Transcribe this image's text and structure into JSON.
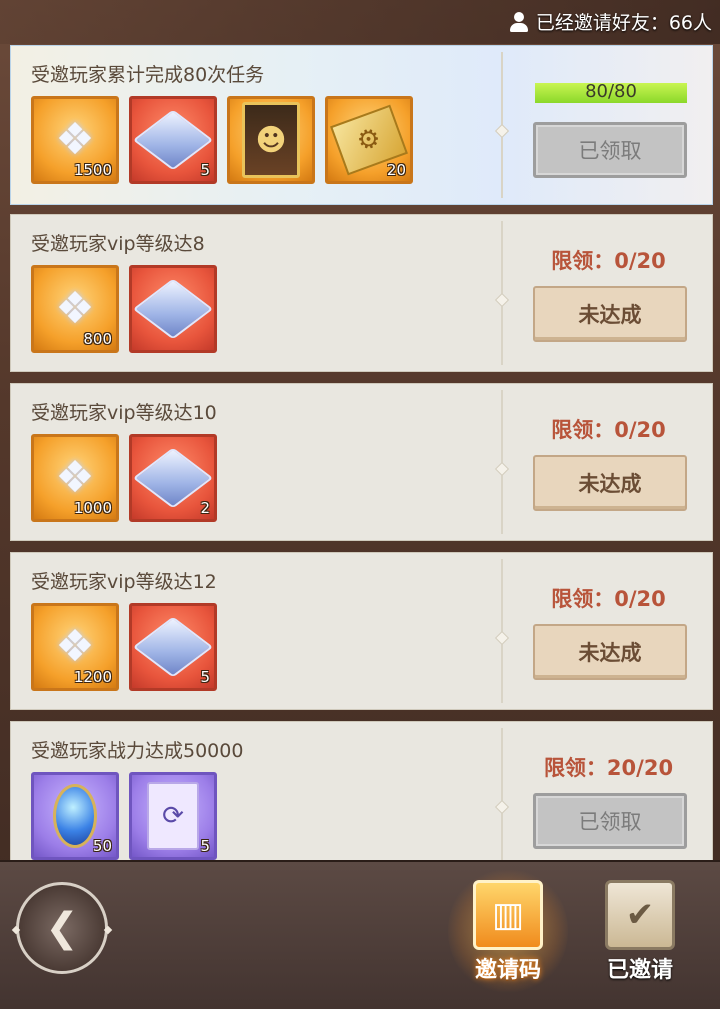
{
  "header": {
    "invited_text": "已经邀请好友：66人"
  },
  "tasks": [
    {
      "title": "受邀玩家累计完成80次任务",
      "items": [
        {
          "icon": "diamond-icon",
          "count": "1500"
        },
        {
          "icon": "crystal-cube-icon",
          "count": "5"
        },
        {
          "icon": "hero-card-icon",
          "count": ""
        },
        {
          "icon": "gold-book-icon",
          "count": "20"
        }
      ],
      "progress": {
        "text": "80/80",
        "value": 80,
        "max": 80
      },
      "button": "已领取",
      "status": "claimed"
    },
    {
      "title": "受邀玩家vip等级达8",
      "items": [
        {
          "icon": "diamond-icon",
          "count": "800"
        },
        {
          "icon": "crystal-cube-icon",
          "count": ""
        }
      ],
      "limit": "限领：0/20",
      "button": "未达成",
      "status": "pending"
    },
    {
      "title": "受邀玩家vip等级达10",
      "items": [
        {
          "icon": "diamond-icon",
          "count": "1000"
        },
        {
          "icon": "crystal-cube-icon",
          "count": "2"
        }
      ],
      "limit": "限领：0/20",
      "button": "未达成",
      "status": "pending"
    },
    {
      "title": "受邀玩家vip等级达12",
      "items": [
        {
          "icon": "diamond-icon",
          "count": "1200"
        },
        {
          "icon": "crystal-cube-icon",
          "count": "5"
        }
      ],
      "limit": "限领：0/20",
      "button": "未达成",
      "status": "pending"
    },
    {
      "title": "受邀玩家战力达成50000",
      "items": [
        {
          "icon": "blue-crystal-icon",
          "count": "50"
        },
        {
          "icon": "scroll-card-icon",
          "count": "5"
        }
      ],
      "limit": "限领：20/20",
      "button": "已领取",
      "status": "claimed"
    }
  ],
  "footer": {
    "back_icon": "back-arrow-icon",
    "tabs": [
      {
        "label": "邀请码",
        "icon": "invite-code-icon",
        "active": true
      },
      {
        "label": "已邀请",
        "icon": "invited-check-icon",
        "active": false
      }
    ]
  }
}
